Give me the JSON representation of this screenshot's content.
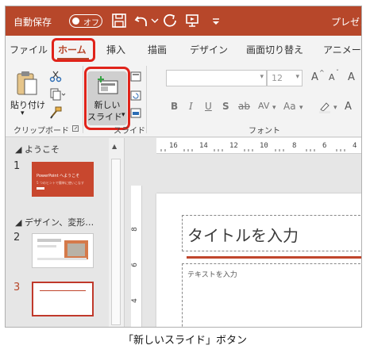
{
  "titlebar": {
    "autosave_label": "自動保存",
    "autosave_state": "オフ",
    "doc_title": "プレゼンテ"
  },
  "tabs": [
    {
      "label": "ファイル",
      "active": false
    },
    {
      "label": "ホーム",
      "active": true
    },
    {
      "label": "挿入",
      "active": false
    },
    {
      "label": "描画",
      "active": false
    },
    {
      "label": "デザイン",
      "active": false
    },
    {
      "label": "画面切り替え",
      "active": false
    },
    {
      "label": "アニメーシ",
      "active": false
    }
  ],
  "ribbon": {
    "clipboard": {
      "paste_label": "貼り付け",
      "paste_arrow": "▾",
      "group_label": "クリップボード"
    },
    "slides": {
      "new_slide_line1": "新しい",
      "new_slide_line2": "スライド",
      "dropdown_arrow": "▾",
      "group_label": "スライド"
    },
    "font": {
      "font_name_value": "",
      "font_size_value": "12",
      "dropdown_arrow": "▾",
      "grow": "A",
      "shrink": "A",
      "clear": "A",
      "bold": "B",
      "italic": "I",
      "underline": "U",
      "shadow": "S",
      "strike": "ab",
      "spacing": "AV",
      "case": "Aa",
      "group_label": "フォント"
    }
  },
  "thumbnails": {
    "sections": [
      {
        "title": "ようこそ"
      },
      {
        "title": "デザイン、変形…"
      }
    ],
    "slides": [
      {
        "number": "1",
        "title_text": "PowerPoint へようこそ",
        "subtitle_text": "5 つのヒントで簡単に使いこなす"
      },
      {
        "number": "2"
      },
      {
        "number": "3"
      }
    ]
  },
  "rulers": {
    "horizontal": [
      "16",
      "14",
      "12",
      "10",
      "8",
      "6",
      "4"
    ],
    "vertical": [
      "8",
      "6",
      "4"
    ]
  },
  "slide": {
    "title_placeholder": "タイトルを入力",
    "body_placeholder": "テキストを入力"
  },
  "caption": "「新しいスライド」ボタン",
  "colors": {
    "accent": "#b7472a",
    "highlight": "#e0231a"
  }
}
